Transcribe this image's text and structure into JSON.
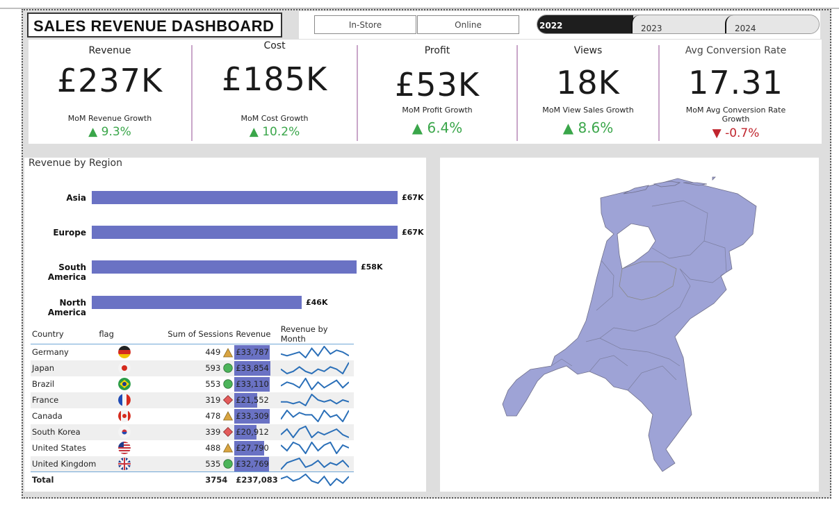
{
  "dashboard": {
    "title": "SALES REVENUE DASHBOARD"
  },
  "channel_slicer": {
    "options": [
      "In-Store",
      "Online"
    ]
  },
  "year_slicer": {
    "options": [
      "2022",
      "2023",
      "2024"
    ],
    "selected": "2022"
  },
  "kpis": [
    {
      "label": "Revenue",
      "value": "£237K",
      "growth_label": "MoM Revenue Growth",
      "growth": "9.3%",
      "direction": "up"
    },
    {
      "label": "Cost",
      "value": "£185K",
      "growth_label": "MoM Cost Growth",
      "growth": "10.2%",
      "direction": "up"
    },
    {
      "label": "Profit",
      "value": "£53K",
      "growth_label": "MoM Profit Growth",
      "growth": "6.4%",
      "direction": "up"
    },
    {
      "label": "Views",
      "value": "18K",
      "growth_label": "MoM View Sales Growth",
      "growth": "8.6%",
      "direction": "up"
    },
    {
      "label": "Avg Conversion Rate",
      "value": "17.31",
      "growth_label": "MoM Avg Conversion Rate Growth",
      "growth": "-0.7%",
      "direction": "down"
    }
  ],
  "region_chart": {
    "title": "Revenue by Region",
    "bar_color": "#6a72c4"
  },
  "chart_data": {
    "type": "bar",
    "orientation": "horizontal",
    "title": "Revenue by Region",
    "categories": [
      "Asia",
      "Europe",
      "South America",
      "North America"
    ],
    "values": [
      67,
      67,
      58,
      46
    ],
    "value_labels": [
      "£67K",
      "£67K",
      "£58K",
      "£46K"
    ],
    "xlim": [
      0,
      67
    ]
  },
  "table": {
    "headers": [
      "Country",
      "flag",
      "Sum of Sessions",
      "Revenue",
      "Revenue by Month"
    ],
    "rows": [
      {
        "country": "Germany",
        "flag": "germany-flag-icon",
        "sessions": "449",
        "indicator": "triangle",
        "revenue": "£33,787",
        "rev_frac": 0.99,
        "spark": [
          4,
          3,
          4,
          5,
          2,
          7,
          3,
          8,
          4,
          6,
          5,
          3
        ]
      },
      {
        "country": "Japan",
        "flag": "japan-flag-icon",
        "sessions": "593",
        "indicator": "circle",
        "revenue": "£33,854",
        "rev_frac": 1.0,
        "spark": [
          5,
          3,
          4,
          6,
          4,
          3,
          5,
          4,
          6,
          5,
          3,
          8
        ]
      },
      {
        "country": "Brazil",
        "flag": "brazil-flag-icon",
        "sessions": "553",
        "indicator": "circle",
        "revenue": "£33,110",
        "rev_frac": 0.98,
        "spark": [
          4,
          6,
          5,
          3,
          8,
          2,
          6,
          3,
          5,
          7,
          3,
          6
        ]
      },
      {
        "country": "France",
        "flag": "france-flag-icon",
        "sessions": "319",
        "indicator": "diamond",
        "revenue": "£21,552",
        "rev_frac": 0.64,
        "spark": [
          4,
          4,
          3,
          4,
          2,
          8,
          5,
          4,
          5,
          3,
          5,
          4
        ]
      },
      {
        "country": "Canada",
        "flag": "canada-flag-icon",
        "sessions": "478",
        "indicator": "triangle",
        "revenue": "£33,309",
        "rev_frac": 0.98,
        "spark": [
          3,
          7,
          4,
          6,
          5,
          5,
          2,
          7,
          4,
          5,
          2,
          7
        ]
      },
      {
        "country": "South Korea",
        "flag": "south-korea-flag-icon",
        "sessions": "339",
        "indicator": "diamond",
        "revenue": "£20,912",
        "rev_frac": 0.62,
        "spark": [
          4,
          6,
          3,
          6,
          7,
          3,
          5,
          4,
          5,
          6,
          4,
          3
        ]
      },
      {
        "country": "United States",
        "flag": "united-states-flag-icon",
        "sessions": "488",
        "indicator": "triangle",
        "revenue": "£27,790",
        "rev_frac": 0.82,
        "spark": [
          5,
          3,
          6,
          5,
          2,
          6,
          3,
          5,
          6,
          2,
          5,
          4
        ]
      },
      {
        "country": "United Kingdom",
        "flag": "united-kingdom-flag-icon",
        "sessions": "535",
        "indicator": "circle",
        "revenue": "£32,769",
        "rev_frac": 0.97,
        "spark": [
          2,
          5,
          6,
          7,
          3,
          4,
          6,
          3,
          5,
          4,
          6,
          3
        ]
      }
    ],
    "total": {
      "label": "Total",
      "sessions": "3754",
      "revenue": "£237,083",
      "spark": [
        5,
        6,
        4,
        5,
        7,
        4,
        3,
        6,
        2,
        5,
        3,
        6
      ]
    }
  },
  "colors": {
    "accent_bar": "#6a72c4",
    "positive": "#3aa64a",
    "negative": "#c0252e",
    "map_fill": "#9ea3d6",
    "spark": "#2a6fb8",
    "triangle": "#d9a441",
    "circle": "#4cb45a",
    "diamond": "#e35b5b"
  },
  "map": {
    "region": "netherlands-map"
  }
}
